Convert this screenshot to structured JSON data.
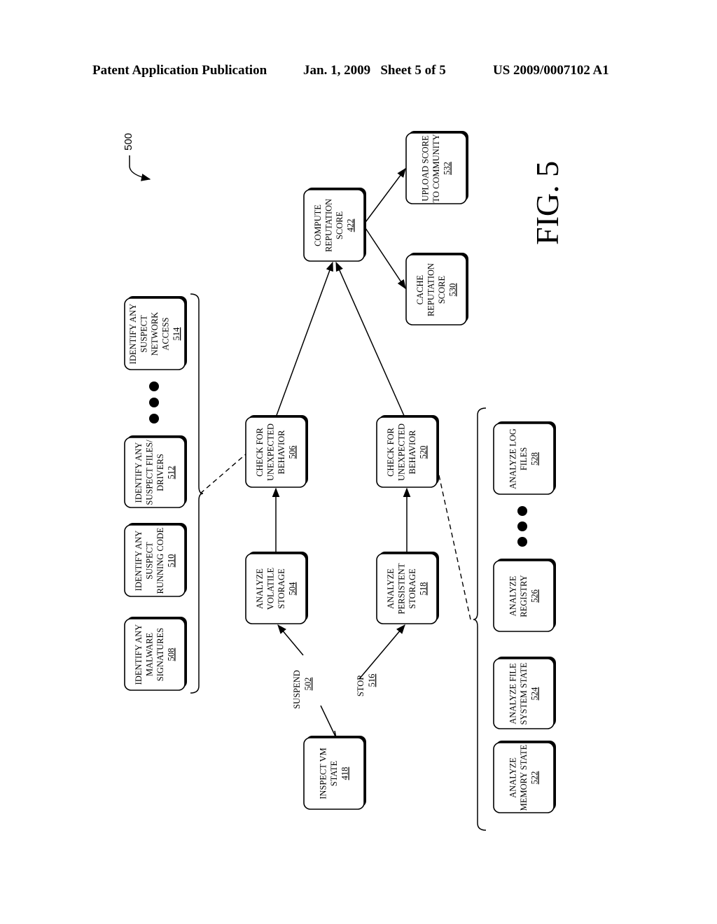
{
  "header": {
    "publication": "Patent Application Publication",
    "date_sheet": "Jan. 1, 2009   Sheet 5 of 5",
    "patent_number": "US 2009/0007102 A1"
  },
  "figure": {
    "label": "FIG. 5",
    "reference": "500"
  },
  "nodes": [
    {
      "id": "418",
      "lines": [
        "INSPECT VM",
        "STATE"
      ],
      "num": "418"
    },
    {
      "id": "504",
      "lines": [
        "ANALYZE",
        "VOLATILE",
        "STORAGE"
      ],
      "num": "504"
    },
    {
      "id": "506",
      "lines": [
        "CHECK FOR",
        "UNEXPECTED",
        "BEHAVIOR"
      ],
      "num": "506"
    },
    {
      "id": "518",
      "lines": [
        "ANALYZE",
        "PERSISTENT",
        "STORAGE"
      ],
      "num": "518"
    },
    {
      "id": "520",
      "lines": [
        "CHECK FOR",
        "UNEXPECTED",
        "BEHAVIOR"
      ],
      "num": "520"
    },
    {
      "id": "422",
      "lines": [
        "COMPUTE",
        "REPUTATION",
        "SCORE"
      ],
      "num": "422"
    },
    {
      "id": "530",
      "lines": [
        "CACHE",
        "REPUTATION",
        "SCORE"
      ],
      "num": "530"
    },
    {
      "id": "532",
      "lines": [
        "UPLOAD SCORE",
        "TO COMMUNITY"
      ],
      "num": "532"
    },
    {
      "id": "508",
      "lines": [
        "IDENTIFY ANY",
        "MALWARE",
        "SIGNATURES"
      ],
      "num": "508"
    },
    {
      "id": "510",
      "lines": [
        "IDENTIFY ANY",
        "SUSPECT",
        "RUNNING CODE"
      ],
      "num": "510"
    },
    {
      "id": "512",
      "lines": [
        "IDENTIFY ANY",
        "SUSPECT FILES/",
        "DRIVERS"
      ],
      "num": "512"
    },
    {
      "id": "514",
      "lines": [
        "IDENTIFY ANY",
        "SUSPECT",
        "NETWORK",
        "ACCESS"
      ],
      "num": "514"
    },
    {
      "id": "522",
      "lines": [
        "ANALYZE",
        "MEMORY STATE"
      ],
      "num": "522"
    },
    {
      "id": "524",
      "lines": [
        "ANALYZE FILE",
        "SYSTEM STATE"
      ],
      "num": "524"
    },
    {
      "id": "526",
      "lines": [
        "ANALYZE",
        "REGISTRY"
      ],
      "num": "526"
    },
    {
      "id": "528",
      "lines": [
        "ANALYZE LOG",
        "FILES"
      ],
      "num": "528"
    }
  ],
  "edge_labels": [
    {
      "id": "suspend",
      "text": "SUSPEND",
      "num": "502"
    },
    {
      "id": "stop",
      "text": "STOP",
      "num": "516"
    }
  ],
  "edges": [
    {
      "from": "418",
      "to": "504",
      "label": "suspend"
    },
    {
      "from": "418",
      "to": "518",
      "label": "stop"
    },
    {
      "from": "504",
      "to": "506"
    },
    {
      "from": "518",
      "to": "520"
    },
    {
      "from": "506",
      "to": "422"
    },
    {
      "from": "520",
      "to": "422"
    },
    {
      "from": "422",
      "to": "530"
    },
    {
      "from": "422",
      "to": "532"
    }
  ],
  "groups": [
    {
      "parent": "506",
      "members": [
        "508",
        "510",
        "512",
        "514"
      ],
      "ellipsis": true
    },
    {
      "parent": "520",
      "members": [
        "522",
        "524",
        "526",
        "528"
      ],
      "ellipsis": true
    }
  ]
}
